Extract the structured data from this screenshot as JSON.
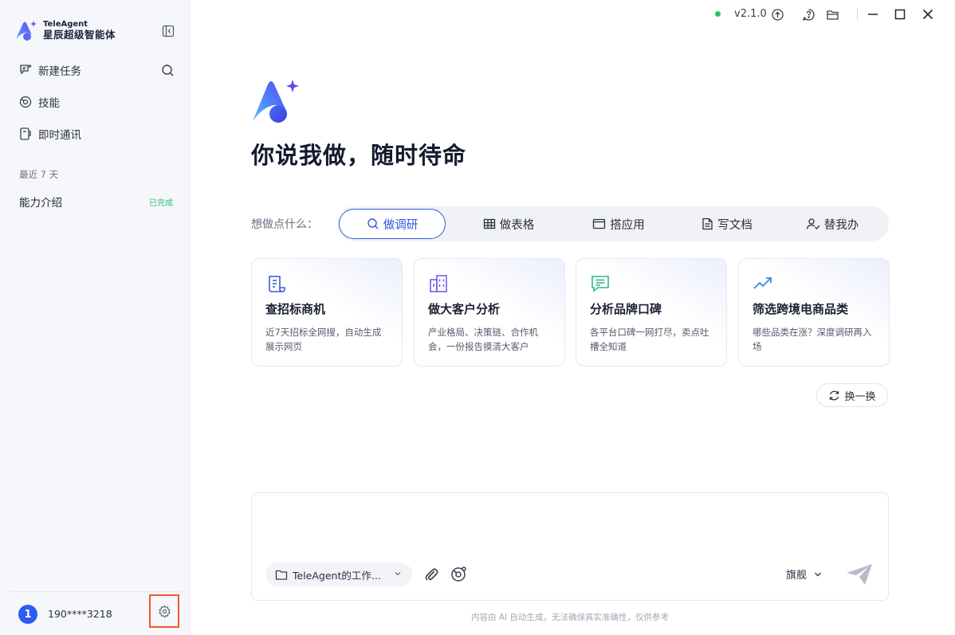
{
  "brand": {
    "name_en": "TeleAgent",
    "name_cn": "星辰超级智能体"
  },
  "sidebar": {
    "nav": [
      {
        "label": "新建任务",
        "icon": "new-task-icon"
      },
      {
        "label": "技能",
        "icon": "skills-icon"
      },
      {
        "label": "即时通讯",
        "icon": "messaging-icon"
      }
    ],
    "section_label": "最近 7 天",
    "history": [
      {
        "title": "能力介绍",
        "status": "已完成"
      }
    ],
    "user": {
      "avatar_text": "1",
      "name": "190****3218"
    }
  },
  "titlebar": {
    "version": "v2.1.0",
    "status_color": "#27c46b"
  },
  "hero": {
    "title": "你说我做，随时待命"
  },
  "tabs": {
    "prompt": "想做点什么：",
    "items": [
      {
        "label": "做调研",
        "icon": "search-icon",
        "active": true
      },
      {
        "label": "做表格",
        "icon": "table-icon",
        "active": false
      },
      {
        "label": "搭应用",
        "icon": "app-window-icon",
        "active": false
      },
      {
        "label": "写文档",
        "icon": "document-icon",
        "active": false
      },
      {
        "label": "替我办",
        "icon": "person-check-icon",
        "active": false
      }
    ]
  },
  "cards": [
    {
      "title": "查招标商机",
      "desc": "近7天招标全网搜，自动生成展示网页",
      "icon": "scroll-icon"
    },
    {
      "title": "做大客户分析",
      "desc": "产业格局、决策链、合作机会，一份报告摸清大客户",
      "icon": "building-icon"
    },
    {
      "title": "分析品牌口碑",
      "desc": "各平台口碑一网打尽，卖点吐槽全知道",
      "icon": "comment-icon"
    },
    {
      "title": "筛选跨境电商品类",
      "desc": "哪些品类在涨？深度调研再入场",
      "icon": "trending-up-icon"
    }
  ],
  "refresh": {
    "label": "换一换"
  },
  "composer": {
    "placeholder": "",
    "workspace_label": "TeleAgent的工作...",
    "model_label": "旗舰"
  },
  "footer": {
    "disclaimer": "内容由 AI 自动生成，无法确保真实准确性，仅供参考"
  },
  "colors": {
    "accent": "#2f55e4",
    "brand_blue": "#3d6cf5",
    "brand_purple": "#8b5cf6",
    "success": "#2fbf71",
    "highlight_border": "#f15a29"
  }
}
